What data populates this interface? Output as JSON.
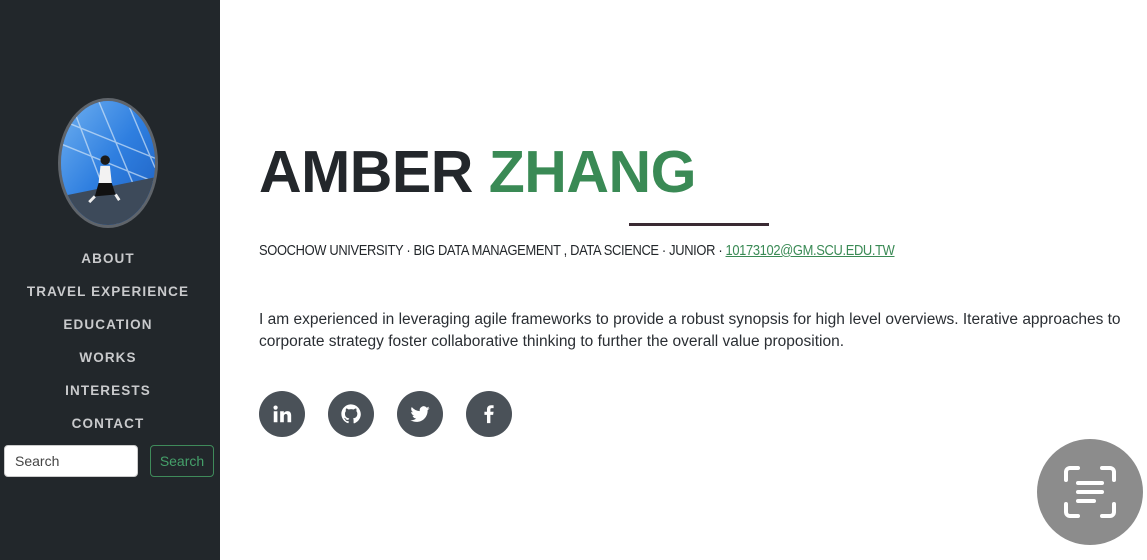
{
  "sidebar": {
    "nav": [
      {
        "label": "ABOUT"
      },
      {
        "label": "TRAVEL EXPERIENCE"
      },
      {
        "label": "EDUCATION"
      },
      {
        "label": "WORKS"
      },
      {
        "label": "INTERESTS"
      },
      {
        "label": "CONTACT"
      }
    ],
    "search": {
      "placeholder": "Search",
      "button_label": "Search"
    }
  },
  "profile": {
    "first_name": "AMBER",
    "last_name": "ZHANG",
    "school": "SOOCHOW UNIVERSITY",
    "major": "BIG DATA MANAGEMENT , DATA SCIENCE",
    "year": "JUNIOR",
    "email": "10173102@GM.SCU.EDU.TW",
    "separator": " · ",
    "bio": "I am experienced in leveraging agile frameworks to provide a robust synopsis for high level overviews. Iterative approaches to corporate strategy foster collaborative thinking to further the overall value proposition."
  },
  "social": [
    {
      "icon": "linkedin-icon"
    },
    {
      "icon": "github-icon"
    },
    {
      "icon": "twitter-icon"
    },
    {
      "icon": "facebook-icon"
    }
  ],
  "colors": {
    "sidebar_bg": "#22272b",
    "accent_green": "#3a8a55",
    "social_bg": "#4a5158",
    "heading_dark": "#23272b"
  }
}
